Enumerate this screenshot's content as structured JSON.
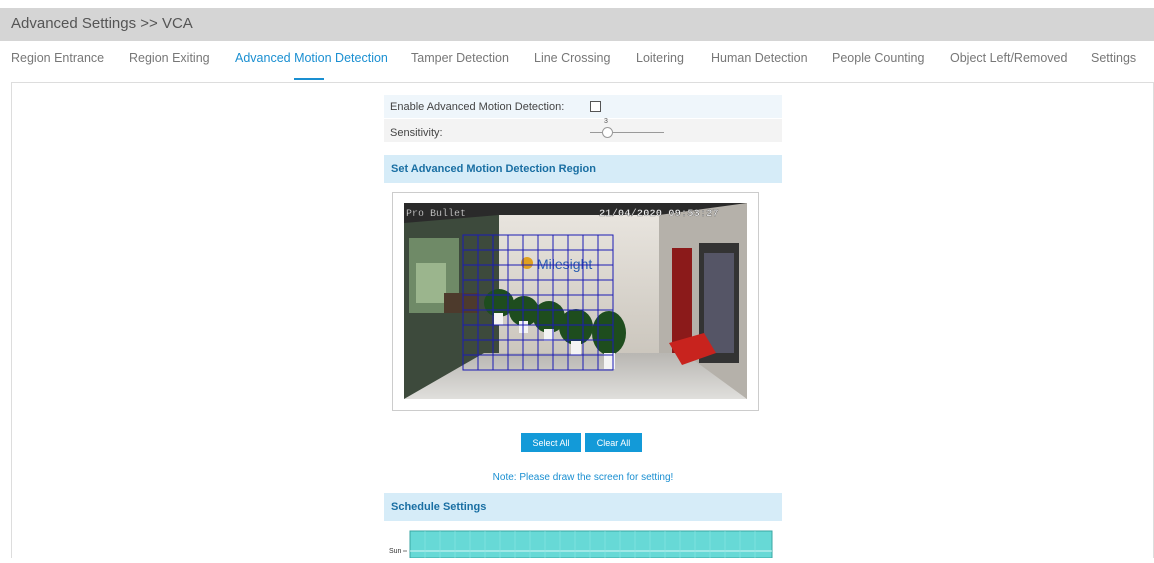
{
  "header": {
    "title": "Advanced Settings >> VCA"
  },
  "tabs": [
    {
      "label": "Region Entrance"
    },
    {
      "label": "Region Exiting"
    },
    {
      "label": "Advanced Motion Detection"
    },
    {
      "label": "Tamper Detection"
    },
    {
      "label": "Line Crossing"
    },
    {
      "label": "Loitering"
    },
    {
      "label": "Human Detection"
    },
    {
      "label": "People Counting"
    },
    {
      "label": "Object Left/Removed"
    },
    {
      "label": "Settings"
    }
  ],
  "active_tab": "Advanced Motion Detection",
  "form": {
    "enable_label": "Enable Advanced Motion Detection:",
    "enable_checked": false,
    "sensitivity_label": "Sensitivity:",
    "sensitivity_value": "3"
  },
  "region": {
    "section_title": "Set Advanced Motion Detection Region",
    "osd_name": "Pro Bullet",
    "osd_time": "21/04/2020 09:53:27",
    "logo_text": "Milesight"
  },
  "buttons": {
    "select_all": "Select All",
    "clear_all": "Clear All"
  },
  "note": "Note: Please draw the screen for setting!",
  "schedule": {
    "section_title": "Schedule Settings",
    "first_day": "Sun"
  },
  "colors": {
    "accent": "#1a8fd1",
    "button": "#139ad8",
    "schedule_fill": "#67d9d6",
    "grid": "#1c1cb4"
  }
}
